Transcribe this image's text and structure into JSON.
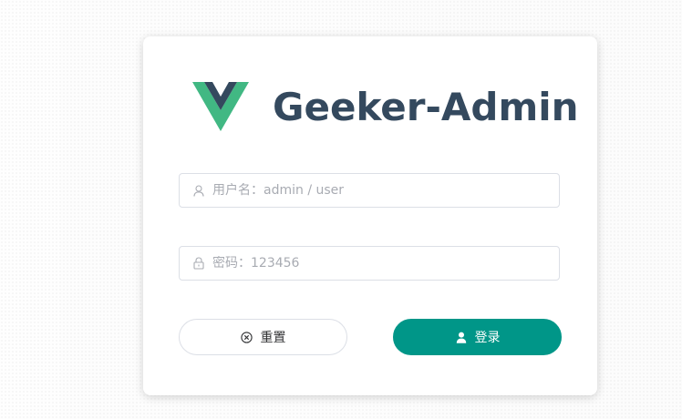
{
  "app": {
    "title": "Geeker-Admin",
    "logo_icon": "vue-logo-icon"
  },
  "form": {
    "username": {
      "placeholder": "用户名：admin / user",
      "value": "",
      "icon": "user-icon"
    },
    "password": {
      "placeholder": "密码：123456",
      "value": "",
      "icon": "lock-icon"
    }
  },
  "buttons": {
    "reset": {
      "label": "重置",
      "icon": "circle-close-icon"
    },
    "login": {
      "label": "登录",
      "icon": "user-filled-icon"
    }
  },
  "colors": {
    "primary": "#009688",
    "title": "#34495e",
    "vue_green": "#41b883",
    "vue_dark": "#34495e",
    "border": "#dcdfe6",
    "placeholder": "#a8abb2"
  }
}
